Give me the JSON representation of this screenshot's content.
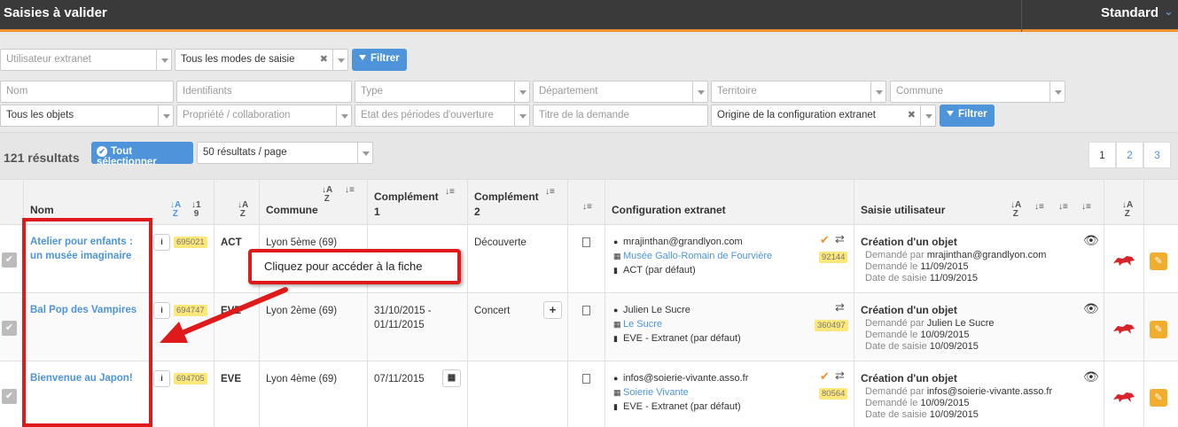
{
  "header": {
    "title": "Saisies à valider",
    "view": "Standard"
  },
  "filters": {
    "row1": {
      "user_placeholder": "Utilisateur extranet",
      "mode_value": "Tous les modes de saisie",
      "filter_label": "Filtrer"
    },
    "row2": {
      "nom": "Nom",
      "identifiants": "Identifiants",
      "type": "Type",
      "departement": "Département",
      "territoire": "Territoire",
      "commune": "Commune"
    },
    "row3": {
      "objets_value": "Tous les objets",
      "propriete": "Propriété / collaboration",
      "etat": "Etat des périodes d'ouverture",
      "titre": "Titre de la demande",
      "origine_value": "Origine de la configuration extranet",
      "filter_label": "Filtrer"
    }
  },
  "results": {
    "count": "121 résultats",
    "select_all": "Tout sélectionner",
    "per_page": "50 résultats / page",
    "pages": [
      "1",
      "2",
      "3"
    ]
  },
  "columns": {
    "nom": "Nom",
    "commune": "Commune",
    "complement1": "Complément 1",
    "complement2": "Complément 2",
    "config": "Configuration extranet",
    "saisie": "Saisie utilisateur"
  },
  "rows": [
    {
      "nom": "Atelier pour enfants : un musée imaginaire",
      "id": "695021",
      "type": "ACT",
      "commune": "Lyon 5ème (69)",
      "c1": "",
      "c2": "Découverte",
      "email": "mrajinthan@grandlyon.com",
      "org": "Musée Gallo-Romain de Fourvière",
      "org_id": "92144",
      "cfg": "ACT (par défaut)",
      "saisie_title": "Création d'un objet",
      "demande_par": "mrajinthan@grandlyon.com",
      "demande_le": "11/09/2015",
      "date_saisie": "11/09/2015"
    },
    {
      "nom": "Bal Pop des Vampires",
      "id": "694747",
      "type": "EVE",
      "commune": "Lyon 2ème (69)",
      "c1": "31/10/2015 - 01/11/2015",
      "c2": "Concert",
      "email": "Julien Le Sucre",
      "org": "Le Sucre",
      "org_id": "360497",
      "cfg": "EVE - Extranet (par défaut)",
      "saisie_title": "Création d'un objet",
      "demande_par": "Julien Le Sucre",
      "demande_le": "10/09/2015",
      "date_saisie": "10/09/2015"
    },
    {
      "nom": "Bienvenue au Japon!",
      "id": "694705",
      "type": "EVE",
      "commune": "Lyon 4ème (69)",
      "c1": "07/11/2015",
      "c2": "",
      "email": "infos@soierie-vivante.asso.fr",
      "org": "Soierie Vivante",
      "org_id": "80564",
      "cfg": "EVE - Extranet (par défaut)",
      "saisie_title": "Création d'un objet",
      "demande_par": "infos@soierie-vivante.asso.fr",
      "demande_le": "10/09/2015",
      "date_saisie": "10/09/2015"
    }
  ],
  "labels": {
    "demande_par": "Demandé par",
    "demande_le": "Demandé le",
    "date_saisie": "Date de saisie"
  },
  "annotation": {
    "callout": "Cliquez pour accéder à la fiche"
  },
  "colors": {
    "accent": "#4d94db",
    "header": "#3a3a3a",
    "orange": "#f0922e",
    "annotation": "#e01a1a"
  }
}
